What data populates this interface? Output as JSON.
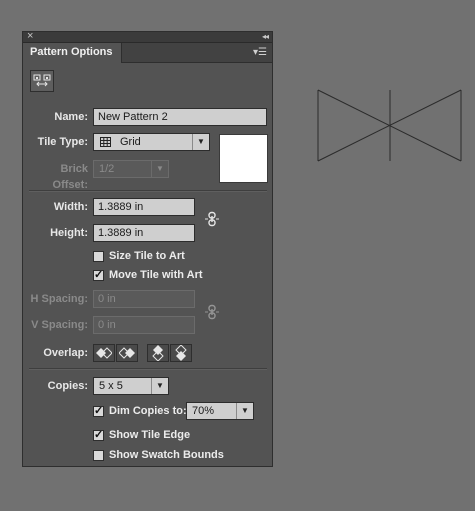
{
  "panel": {
    "title": "Pattern Options",
    "close_glyph": "×",
    "collapse_glyph": "◂◂",
    "menu_glyph": "▾☰",
    "tool_icon": "tile-edit-icon"
  },
  "fields": {
    "name_label": "Name:",
    "name_value": "New Pattern 2",
    "tile_type_label": "Tile Type:",
    "tile_type_value": "Grid",
    "brick_offset_label": "Brick Offset:",
    "brick_offset_value": "1/2",
    "width_label": "Width:",
    "width_value": "1.3889 in",
    "height_label": "Height:",
    "height_value": "1.3889 in",
    "size_tile_to_art": "Size Tile to Art",
    "move_tile_with_art": "Move Tile with Art",
    "h_spacing_label": "H Spacing:",
    "h_spacing_value": "0 in",
    "v_spacing_label": "V Spacing:",
    "v_spacing_value": "0 in",
    "overlap_label": "Overlap:",
    "copies_label": "Copies:",
    "copies_value": "5 x 5",
    "dim_copies_label": "Dim Copies to:",
    "dim_copies_value": "70%",
    "show_tile_edge": "Show Tile Edge",
    "show_swatch_bounds": "Show Swatch Bounds"
  },
  "state": {
    "size_tile_to_art": false,
    "move_tile_with_art": true,
    "dim_copies": true,
    "show_tile_edge": true,
    "show_swatch_bounds": false
  },
  "colors": {
    "background": "#717171",
    "panel": "#535353",
    "artwork_stroke": "#2b2b2b"
  }
}
